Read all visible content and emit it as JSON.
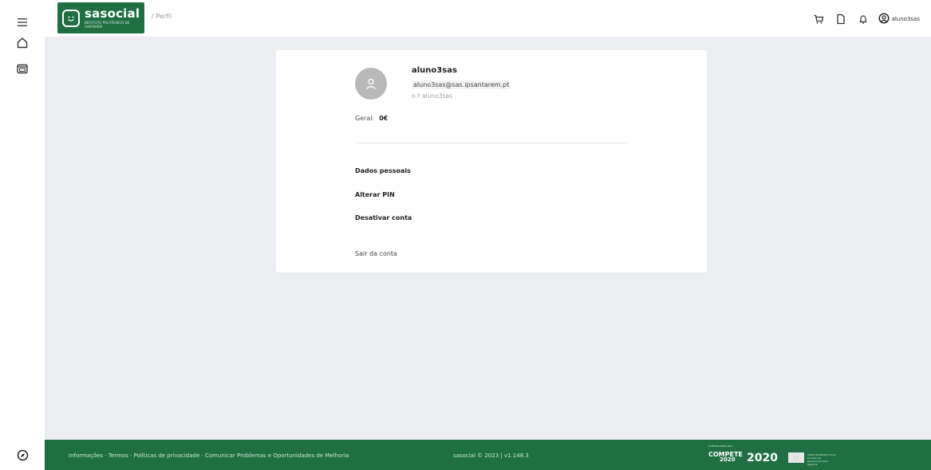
{
  "app": {
    "brand_name": "sasocial",
    "brand_sub": "INSTITUTO POLITÉCNICO DE SANTARÉM",
    "brand_color": "#1f6f43"
  },
  "header": {
    "breadcrumb": "/ Perfil",
    "username": "aluno3sas",
    "icons": [
      "cart-icon",
      "document-icon",
      "bell-icon",
      "user-circle-icon"
    ]
  },
  "sidebar": {
    "items": [
      {
        "name": "menu-icon"
      },
      {
        "name": "home-icon"
      },
      {
        "name": "wallet-icon"
      }
    ],
    "bottom_icon": "compass-icon"
  },
  "profile": {
    "name": "aluno3sas",
    "email": "aluno3sas@sas.ipsantarem.pt",
    "number": "n.º aluno3sas",
    "balance_label": "Geral:",
    "balance_value": "0€"
  },
  "menu": {
    "personal_data": "Dados pessoais",
    "change_pin": "Alterar PIN",
    "deactivate": "Desativar conta",
    "logout": "Sair da conta"
  },
  "footer": {
    "link_info": "Informações",
    "link_terms": "Termos",
    "link_privacy": "Políticas de privacidade",
    "link_report": "Comunicar Problemas e Oportunidades de Melhoria",
    "separator": " · ",
    "copyright": "sasocial © 2023 | v1.148.3",
    "funding_caption": "Cofinanciado por:",
    "compete": "COMPETE",
    "compete_year": "2020",
    "portugal2020": "2020",
    "eu_text": "UNIÃO EUROPEIA Fundo Europeu de Desenvolvimento Regional"
  }
}
